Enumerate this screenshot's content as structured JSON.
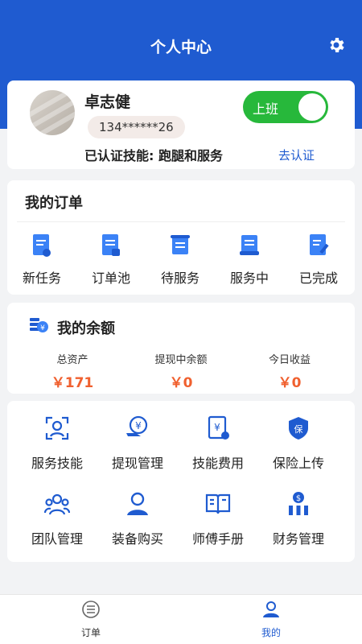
{
  "header": {
    "title": "个人中心",
    "settings_icon": "gear-icon"
  },
  "profile": {
    "name": "卓志健",
    "phone": "134******26",
    "duty_label": "上班",
    "skills_text": "已认证技能: 跑腿和服务",
    "verify_link": "去认证",
    "duty_color": "#27b83b"
  },
  "orders": {
    "title": "我的订单",
    "items": [
      {
        "label": "新任务",
        "icon": "new-task-icon"
      },
      {
        "label": "订单池",
        "icon": "order-pool-icon"
      },
      {
        "label": "待服务",
        "icon": "pending-service-icon"
      },
      {
        "label": "服务中",
        "icon": "in-service-icon"
      },
      {
        "label": "已完成",
        "icon": "completed-icon"
      }
    ]
  },
  "balance": {
    "title": "我的余额",
    "stats": [
      {
        "label": "总资产",
        "value": "￥171"
      },
      {
        "label": "提现中余额",
        "value": "￥0"
      },
      {
        "label": "今日收益",
        "value": "￥0"
      }
    ]
  },
  "tools": [
    {
      "label": "服务技能",
      "icon": "face-scan-icon"
    },
    {
      "label": "提现管理",
      "icon": "withdraw-icon"
    },
    {
      "label": "技能费用",
      "icon": "fee-icon"
    },
    {
      "label": "保险上传",
      "icon": "insurance-shield-icon"
    },
    {
      "label": "团队管理",
      "icon": "team-icon"
    },
    {
      "label": "装备购买",
      "icon": "equipment-person-icon"
    },
    {
      "label": "师傅手册",
      "icon": "manual-book-icon"
    },
    {
      "label": "财务管理",
      "icon": "finance-icon"
    }
  ],
  "nav": [
    {
      "label": "订单",
      "icon": "orders-list-icon"
    },
    {
      "label": "我的",
      "icon": "profile-user-icon"
    }
  ],
  "colors": {
    "primary": "#1f5bd0",
    "accent": "#f0602f",
    "nav_active": "#1f5bd0",
    "nav_inactive": "#333333"
  }
}
